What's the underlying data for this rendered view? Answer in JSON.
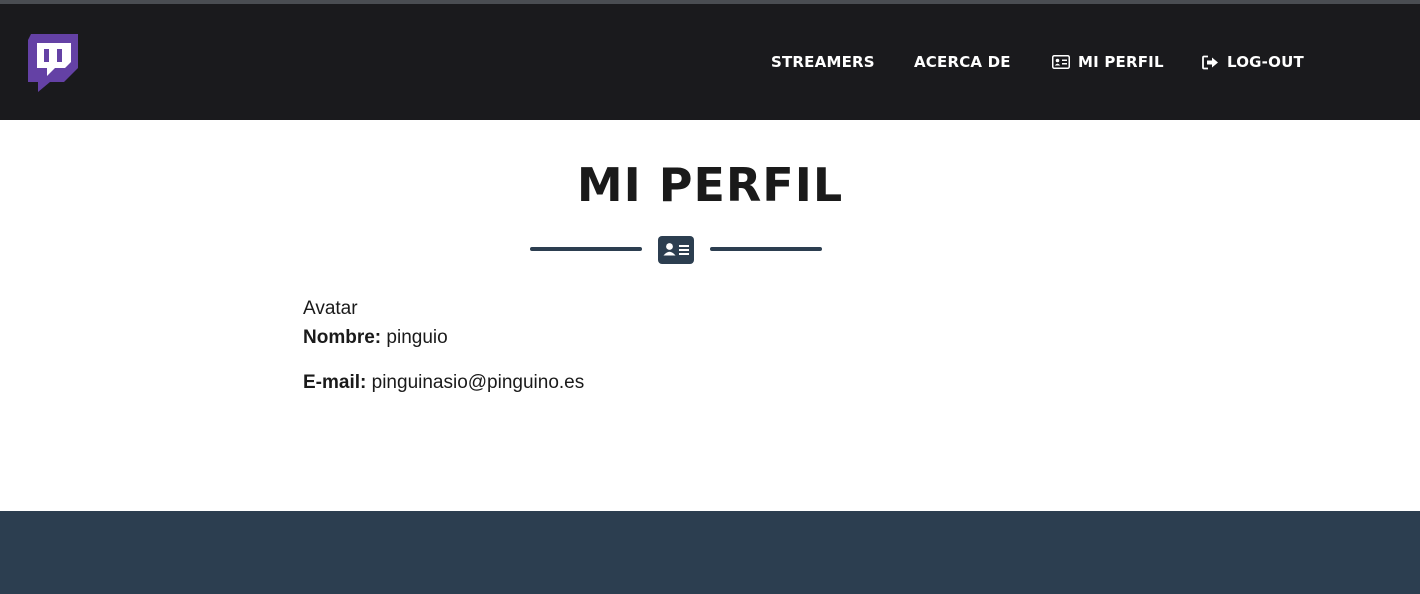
{
  "brand": {
    "logo_icon": "twitch-logo-icon",
    "color": "#6441a5"
  },
  "nav": {
    "items": [
      {
        "label": "STREAMERS"
      },
      {
        "label": "ACERCA DE"
      },
      {
        "label": "MI PERFIL",
        "icon": "id-card-icon"
      },
      {
        "label": "LOG-OUT",
        "icon": "sign-out-icon"
      }
    ]
  },
  "page": {
    "title": "MI PERFIL",
    "divider_icon": "id-card-icon",
    "avatar_label": "Avatar",
    "nombre_label": "Nombre:",
    "nombre_value": "pinguio",
    "email_label": "E-mail:",
    "email_value": "pinguinasio@pinguino.es"
  },
  "colors": {
    "navbar_bg": "#1a1a1d",
    "accent": "#2c3e50",
    "footer_bg": "#2c3e50"
  }
}
